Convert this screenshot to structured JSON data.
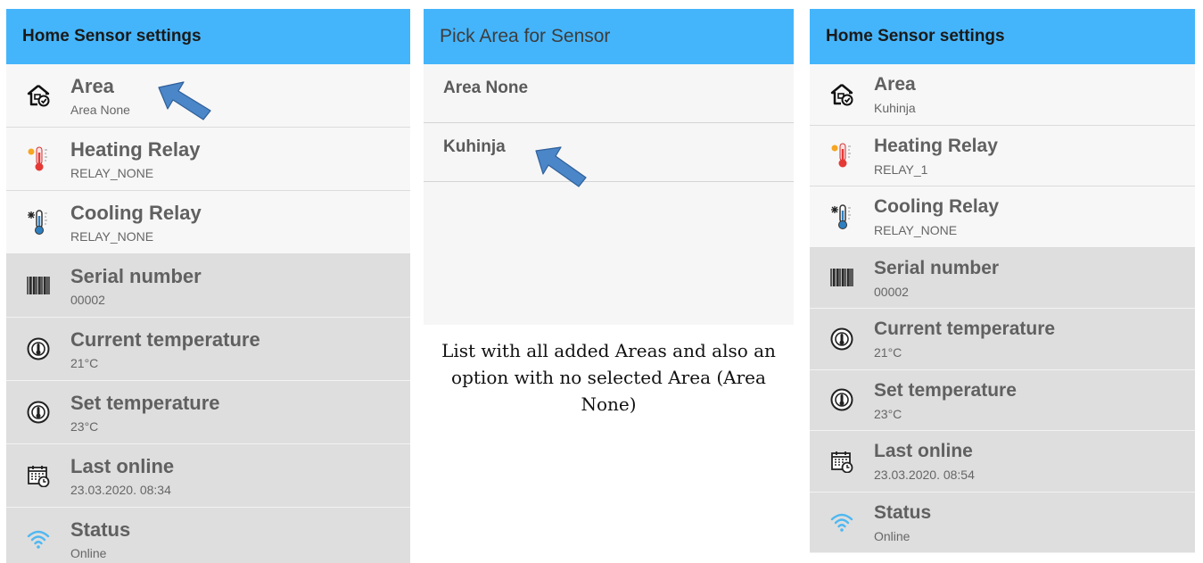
{
  "left_screen": {
    "title": "Home Sensor settings",
    "rows": [
      {
        "title": "Area",
        "sub": "Area None",
        "icon": "home-area-icon"
      },
      {
        "title": "Heating Relay",
        "sub": "RELAY_NONE",
        "icon": "thermometer-hot-icon"
      },
      {
        "title": "Cooling Relay",
        "sub": "RELAY_NONE",
        "icon": "thermometer-cold-icon"
      },
      {
        "title": "Serial number",
        "sub": "00002",
        "icon": "barcode-icon"
      },
      {
        "title": "Current temperature",
        "sub": "21°C",
        "icon": "thermostat-dial-icon"
      },
      {
        "title": "Set temperature",
        "sub": "23°C",
        "icon": "thermostat-dial-icon"
      },
      {
        "title": "Last online",
        "sub": "23.03.2020. 08:34",
        "icon": "calendar-clock-icon"
      },
      {
        "title": "Status",
        "sub": "Online",
        "icon": "wifi-icon"
      }
    ]
  },
  "middle_screen": {
    "title": "Pick Area for Sensor",
    "items": [
      "Area None",
      "Kuhinja"
    ],
    "caption": "List with all added Areas and also an option with no selected Area (Area None)"
  },
  "right_screen": {
    "title": "Home Sensor settings",
    "rows": [
      {
        "title": "Area",
        "sub": "Kuhinja",
        "icon": "home-area-icon"
      },
      {
        "title": "Heating Relay",
        "sub": "RELAY_1",
        "icon": "thermometer-hot-icon"
      },
      {
        "title": "Cooling Relay",
        "sub": "RELAY_NONE",
        "icon": "thermometer-cold-icon"
      },
      {
        "title": "Serial number",
        "sub": "00002",
        "icon": "barcode-icon"
      },
      {
        "title": "Current temperature",
        "sub": "21°C",
        "icon": "thermostat-dial-icon"
      },
      {
        "title": "Set temperature",
        "sub": "23°C",
        "icon": "thermostat-dial-icon"
      },
      {
        "title": "Last online",
        "sub": "23.03.2020. 08:54",
        "icon": "calendar-clock-icon"
      },
      {
        "title": "Status",
        "sub": "Online",
        "icon": "wifi-icon"
      }
    ]
  },
  "colors": {
    "appbar": "#45b5fb",
    "arrow": "#4a86c8",
    "wifi": "#4fb8f0",
    "heat": "#e53935",
    "cold": "#2e7fc0"
  }
}
